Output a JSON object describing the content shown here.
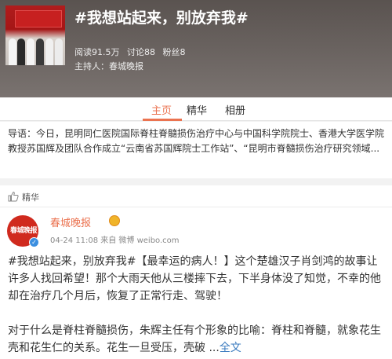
{
  "header": {
    "title": "#我想站起来，别放弃我#",
    "stats": {
      "reads": "阅读91.5万",
      "discussions": "讨论88",
      "fans": "粉丝8"
    },
    "host": "主持人：春城晚报"
  },
  "tabs": [
    {
      "label": "主页",
      "active": true
    },
    {
      "label": "精华",
      "active": false
    },
    {
      "label": "相册",
      "active": false
    }
  ],
  "guide": "导语：今日，昆明同仁医院国际脊柱脊髓损伤治疗中心与中国科学院院士、香港大学医学院教授苏国辉及团队合作成立“云南省苏国辉院士工作站”、“昆明市脊髓损伤治疗研究领域...",
  "essence": {
    "label": "精华",
    "icon": "thumbs-up-icon"
  },
  "post": {
    "author": "春城晚报",
    "avatar_text": "春城晚报",
    "verified": true,
    "meta": "04-24 11:08 来自 微博 weibo.com",
    "para1": "#我想站起来，别放弃我#【最幸运的病人！】这个楚雄汉子肖剑鸿的故事让许多人找回希望！那个大雨天他从三楼摔下去，下半身体没了知觉，不幸的他却在治疗几个月后，恢复了正常行走、驾驶！",
    "para2": "对于什么是脊柱脊髓损伤，朱辉主任有个形象的比喻：脊柱和脊髓，就象花生壳和花生仁的关系。花生一旦受压，壳破 ...",
    "fulltext_link": "全文"
  },
  "colors": {
    "accent": "#eb7350",
    "link": "#3b7bbf"
  }
}
